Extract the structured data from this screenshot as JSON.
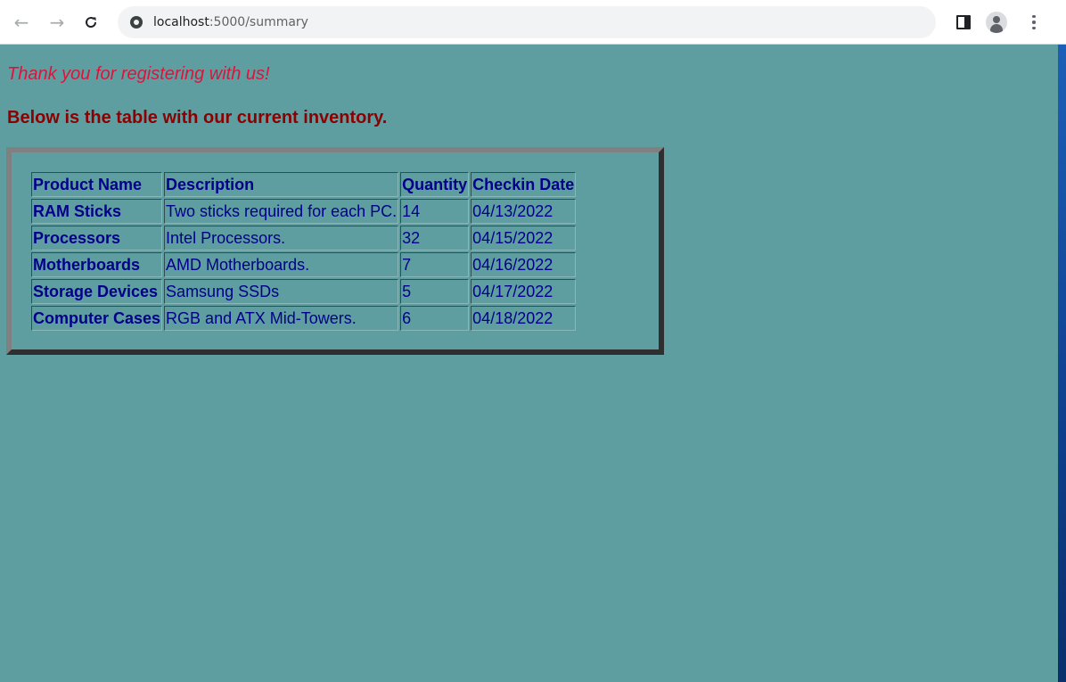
{
  "browser": {
    "url_host": "localhost",
    "url_rest": ":5000/summary",
    "back_icon": "arrow-left-icon",
    "forward_icon": "arrow-right-icon",
    "reload_icon": "reload-icon"
  },
  "page": {
    "thanks": "Thank you for registering with us!",
    "subtitle": "Below is the table with our current inventory.",
    "colors": {
      "background": "#5f9ea0",
      "thanks_text": "#dc143c",
      "subtitle_text": "#8b0000",
      "table_text": "#00008b"
    }
  },
  "inventory": {
    "headers": [
      "Product Name",
      "Description",
      "Quantity",
      "Checkin Date"
    ],
    "rows": [
      [
        "RAM Sticks",
        "Two sticks required for each PC.",
        "14",
        "04/13/2022"
      ],
      [
        "Processors",
        "Intel Processors.",
        "32",
        "04/15/2022"
      ],
      [
        "Motherboards",
        "AMD Motherboards.",
        "7",
        "04/16/2022"
      ],
      [
        "Storage Devices",
        "Samsung SSDs",
        "5",
        "04/17/2022"
      ],
      [
        "Computer Cases",
        "RGB and ATX Mid-Towers.",
        "6",
        "04/18/2022"
      ]
    ]
  }
}
